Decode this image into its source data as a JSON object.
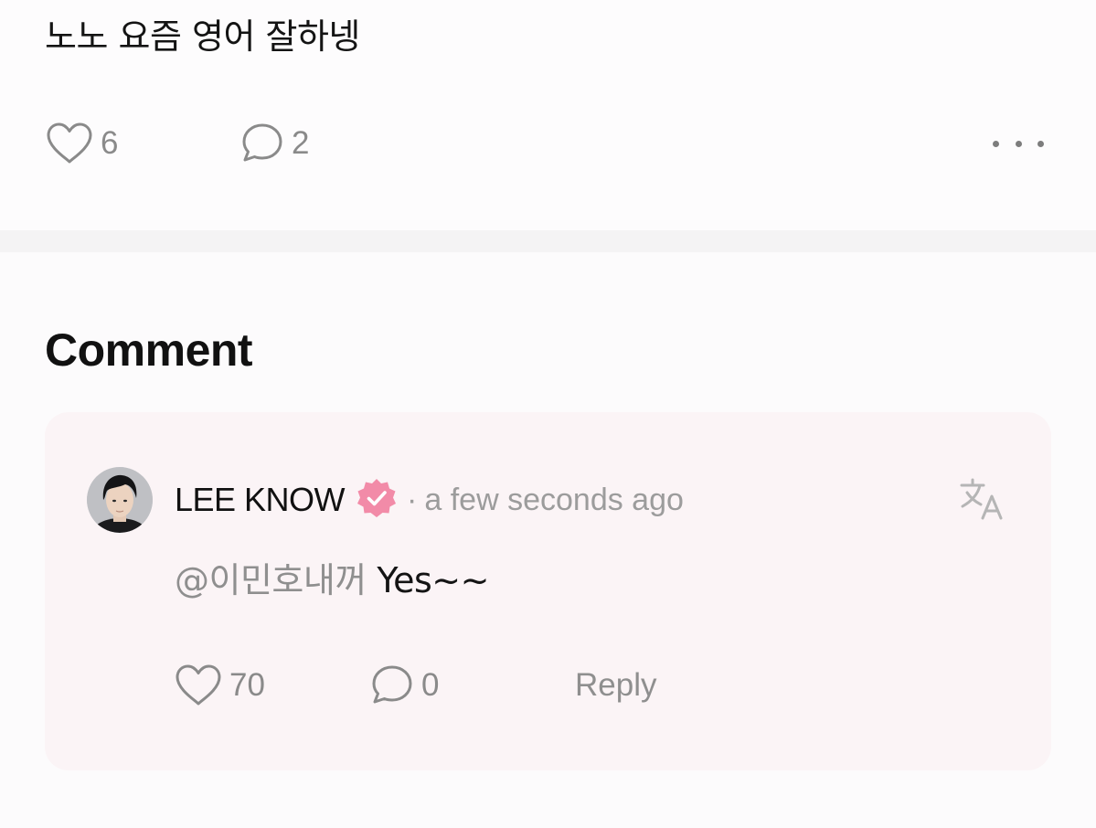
{
  "post": {
    "text": "노노 요즘 영어 잘하넹",
    "like_count": "6",
    "comment_count": "2"
  },
  "comments_section": {
    "title": "Comment"
  },
  "comment": {
    "author": "LEE KNOW",
    "separator": "·",
    "timestamp": "a few seconds ago",
    "mention": "@이민호내꺼",
    "text": "Yes~~",
    "like_count": "70",
    "reply_count": "0",
    "reply_label": "Reply"
  },
  "icons": {
    "like": "heart-icon",
    "comment": "speech-bubble-icon",
    "more": "more-dots-icon",
    "verified": "verified-badge-icon",
    "translate": "translate-icon"
  },
  "colors": {
    "verified_badge": "#f28ba8",
    "card_background": "#fbf4f6",
    "muted_text": "#8f8f8f"
  }
}
